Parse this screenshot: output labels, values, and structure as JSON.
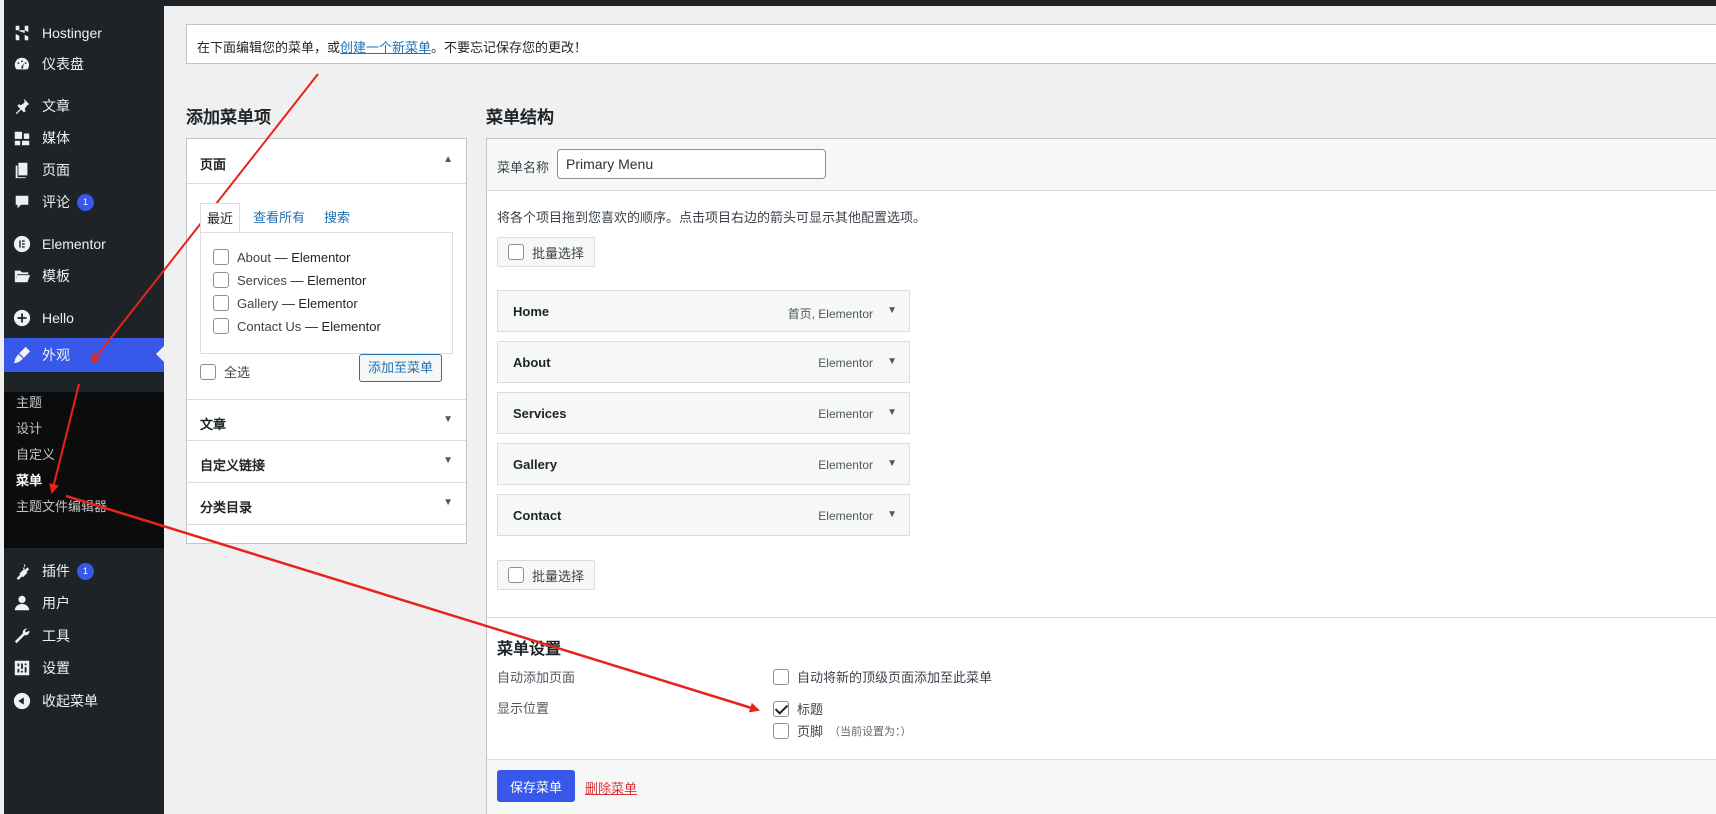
{
  "sidebar": {
    "items": [
      {
        "label": "Hostinger",
        "icon": "hostinger-logo-icon"
      },
      {
        "label": "仪表盘",
        "icon": "dashboard-icon"
      },
      {
        "label": "文章",
        "icon": "pin-icon"
      },
      {
        "label": "媒体",
        "icon": "media-icon"
      },
      {
        "label": "页面",
        "icon": "page-icon"
      },
      {
        "label": "评论",
        "icon": "comment-icon",
        "badge": "1"
      },
      {
        "label": "Elementor",
        "icon": "elementor-icon"
      },
      {
        "label": "模板",
        "icon": "folder-icon"
      },
      {
        "label": "Hello",
        "icon": "plus-circle-icon"
      },
      {
        "label": "外观",
        "icon": "brush-icon"
      },
      {
        "label": "插件",
        "icon": "plugin-icon",
        "badge": "1"
      },
      {
        "label": "用户",
        "icon": "user-icon"
      },
      {
        "label": "工具",
        "icon": "wrench-icon"
      },
      {
        "label": "设置",
        "icon": "settings-icon"
      },
      {
        "label": "收起菜单",
        "icon": "collapse-icon"
      }
    ],
    "submenu": [
      "主题",
      "设计",
      "自定义",
      "菜单",
      "主题文件编辑器"
    ]
  },
  "notice": {
    "before": "在下面编辑您的菜单，或",
    "link": "创建一个新菜单",
    "after": "。不要忘记保存您的更改！"
  },
  "add_items": {
    "heading": "添加菜单项",
    "pages_label": "页面",
    "tabs": [
      "最近",
      "查看所有",
      "搜索"
    ],
    "pages": [
      {
        "title": "About",
        "suffix": "— Elementor"
      },
      {
        "title": "Services",
        "suffix": "— Elementor"
      },
      {
        "title": "Gallery",
        "suffix": "— Elementor"
      },
      {
        "title": "Contact Us",
        "suffix": "— Elementor"
      }
    ],
    "select_all": "全选",
    "add_button": "添加至菜单",
    "sections": [
      "文章",
      "自定义链接",
      "分类目录"
    ]
  },
  "structure": {
    "heading": "菜单结构",
    "name_label": "菜单名称",
    "name_value": "Primary Menu",
    "instructions": "将各个项目拖到您喜欢的顺序。点击项目右边的箭头可显示其他配置选项。",
    "bulk_select": "批量选择",
    "items": [
      {
        "title": "Home",
        "type": "首页, Elementor"
      },
      {
        "title": "About",
        "type": "Elementor"
      },
      {
        "title": "Services",
        "type": "Elementor"
      },
      {
        "title": "Gallery",
        "type": "Elementor"
      },
      {
        "title": "Contact",
        "type": "Elementor"
      }
    ]
  },
  "settings": {
    "heading": "菜单设置",
    "auto_add_label": "自动添加页面",
    "auto_add_option": "自动将新的顶级页面添加至此菜单",
    "auto_add_checked": false,
    "location_label": "显示位置",
    "locations": [
      {
        "label": "标题",
        "checked": true,
        "note": ""
      },
      {
        "label": "页脚",
        "checked": false,
        "note": "（当前设置为：）"
      }
    ]
  },
  "actions": {
    "save": "保存菜单",
    "delete": "删除菜单"
  },
  "colors": {
    "sidebar_bg": "#1d2327",
    "active_bg": "#3858e9",
    "link": "#2271b1",
    "delete": "#d63638",
    "annotation": "#e8231a"
  }
}
